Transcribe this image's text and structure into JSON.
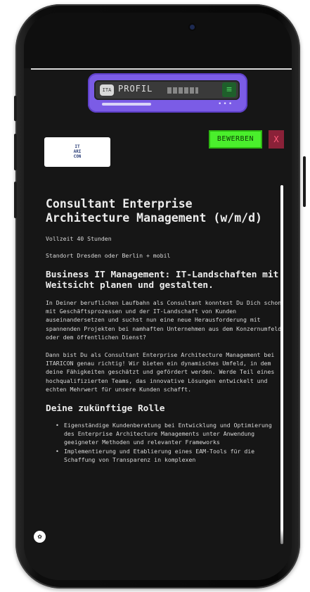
{
  "profil_widget": {
    "icon_text": "ITA",
    "label": "PROFIL",
    "menu_icon": "≡",
    "dots": "•••"
  },
  "actions": {
    "apply_label": "BEWERBEN",
    "close_label": "X"
  },
  "logo": {
    "text": "IT\nARI\nCON"
  },
  "job": {
    "title": "Consultant Enterprise Architecture Management (w/m/d)",
    "hours": "Vollzeit 40 Stunden",
    "location": "Standort Dresden oder Berlin + mobil",
    "subtitle": "Business IT Management: IT-Landschaften mit Weitsicht planen und gestalten.",
    "paragraph1": "In Deiner beruflichen Laufbahn als Consultant konntest Du Dich schon mit Geschäftsprozessen und der IT-Landschaft von Kunden auseinandersetzen und suchst nun eine neue Herausforderung mit spannenden Projekten bei namhaften Unternehmen aus dem Konzernumfeld oder dem öffentlichen Dienst?",
    "paragraph2": "Dann bist Du als Consultant Enterprise Architecture Management bei ITARICON genau richtig! Wir bieten ein dynamisches Umfeld, in dem deine Fähigkeiten geschätzt und gefördert werden. Werde Teil eines hochqualifizierten Teams, das innovative Lösungen entwickelt und echten Mehrwert für unsere Kunden schafft.",
    "section_heading": "Deine zukünftige Rolle",
    "bullets": [
      "Eigenständige Kundenberatung bei Entwicklung und Optimierung des Enterprise Architecture Managements unter Anwendung geeigneter Methoden und relevanter Frameworks",
      "Implementierung und Etablierung eines EAM-Tools für die Schaffung von Transparenz in komplexen"
    ]
  },
  "cookie_icon": "cookie-icon",
  "colors": {
    "accent_purple": "#7b5ce6",
    "apply_green": "#4aef2c",
    "close_red": "#8a2138",
    "background": "#161616"
  }
}
